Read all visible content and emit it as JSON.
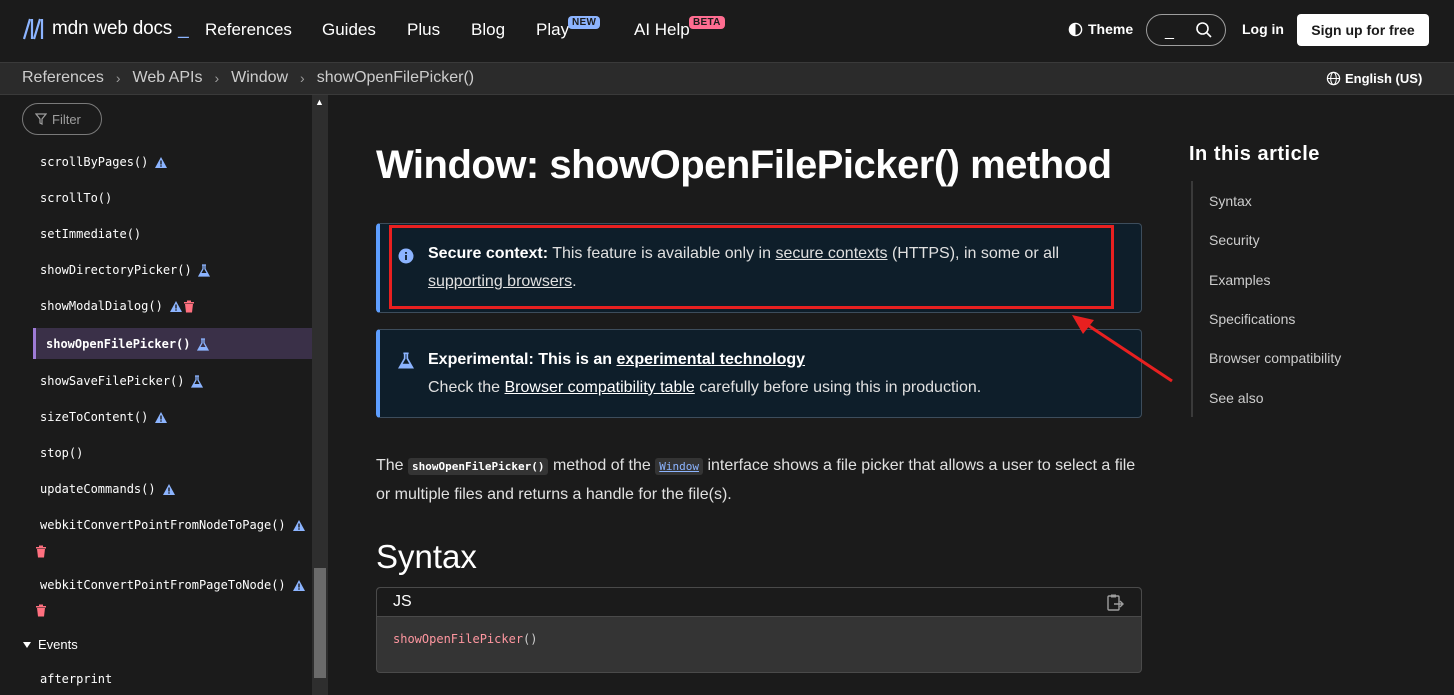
{
  "header": {
    "logo_text": "mdn web docs",
    "logo_cursor": "_",
    "nav": {
      "references": "References",
      "guides": "Guides",
      "plus": "Plus",
      "blog": "Blog",
      "play": "Play",
      "play_badge": "NEW",
      "ai_help": "AI Help",
      "ai_badge": "BETA"
    },
    "theme_label": "Theme",
    "search_underscore": "_",
    "login_label": "Log in",
    "signup_label": "Sign up for free"
  },
  "breadcrumb": {
    "items": [
      "References",
      "Web APIs",
      "Window",
      "showOpenFilePicker()"
    ],
    "separator": "›",
    "language": "English (US)"
  },
  "sidebar": {
    "filter_placeholder": "Filter",
    "items": [
      {
        "label": "scrollByPages()",
        "icons": [
          "warning-icon"
        ]
      },
      {
        "label": "scrollTo()",
        "icons": []
      },
      {
        "label": "setImmediate()",
        "icons": []
      },
      {
        "label": "showDirectoryPicker()",
        "icons": [
          "flask-icon"
        ]
      },
      {
        "label": "showModalDialog()",
        "icons": [
          "warning-icon",
          "trash-icon"
        ]
      },
      {
        "label": "showOpenFilePicker()",
        "icons": [
          "flask-icon"
        ],
        "active": true
      },
      {
        "label": "showSaveFilePicker()",
        "icons": [
          "flask-icon"
        ]
      },
      {
        "label": "sizeToContent()",
        "icons": [
          "warning-icon"
        ]
      },
      {
        "label": "stop()",
        "icons": []
      },
      {
        "label": "updateCommands()",
        "icons": [
          "warning-icon"
        ]
      },
      {
        "label": "webkitConvertPointFromNodeToPage()",
        "icons": [
          "warning-icon",
          "trash-icon"
        ]
      },
      {
        "label": "webkitConvertPointFromPageToNode()",
        "icons": [
          "warning-icon",
          "trash-icon"
        ]
      }
    ],
    "events_label": "Events",
    "events_items": [
      "afterprint"
    ]
  },
  "main": {
    "title": "Window: showOpenFilePicker() method",
    "secure_note": {
      "label": "Secure context:",
      "text1": "This feature is available only in",
      "link1": "secure contexts",
      "text2": "(HTTPS), in some or all",
      "link2": "supporting browsers",
      "text3": "."
    },
    "experimental_note": {
      "label": "Experimental: This is an",
      "link1": "experimental technology",
      "text1": "Check the",
      "link2": "Browser compatibility table",
      "text2": "carefully before using this in production."
    },
    "intro": {
      "t1": "The",
      "code1": "showOpenFilePicker()",
      "t2": "method of the",
      "code2": "Window",
      "t3": "interface shows a file picker that allows a user to select a file or multiple files and returns a handle for the file(s)."
    },
    "syntax_heading": "Syntax",
    "code": {
      "lang": "JS",
      "fn": "showOpenFilePicker",
      "parens": "()"
    }
  },
  "toc": {
    "title": "In this article",
    "items": [
      "Syntax",
      "Security",
      "Examples",
      "Specifications",
      "Browser compatibility",
      "See also"
    ]
  },
  "colors": {
    "accent": "#8cb4ff",
    "note_border": "#5e9eff",
    "highlight_box": "#e82020",
    "active_sidebar": "#9e7bd6"
  }
}
